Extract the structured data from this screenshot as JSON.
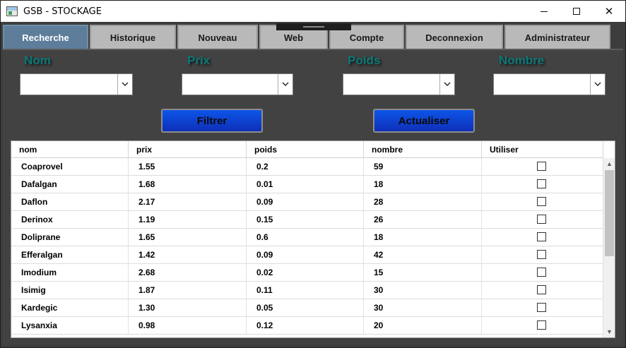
{
  "window": {
    "title": "GSB - STOCKAGE",
    "minimize_glyph": "",
    "close_glyph": "✕"
  },
  "tabs": [
    {
      "label": "Recherche",
      "active": true
    },
    {
      "label": "Historique",
      "active": false
    },
    {
      "label": "Nouveau",
      "active": false
    },
    {
      "label": "Web",
      "active": false
    },
    {
      "label": "Compte",
      "active": false
    },
    {
      "label": "Deconnexion",
      "active": false
    },
    {
      "label": "Administrateur",
      "active": false
    }
  ],
  "filters": {
    "nom_label": "Nom",
    "prix_label": "Prix",
    "poids_label": "Poids",
    "nombre_label": "Nombre",
    "nom_value": "",
    "prix_value": "",
    "poids_value": "",
    "nombre_value": ""
  },
  "buttons": {
    "filtrer": "Filtrer",
    "actualiser": "Actualiser"
  },
  "table": {
    "columns": [
      "nom",
      "prix",
      "poids",
      "nombre",
      "Utiliser"
    ],
    "rows": [
      {
        "nom": "Coaprovel",
        "prix": "1.55",
        "poids": "0.2",
        "nombre": "59",
        "utiliser": false
      },
      {
        "nom": "Dafalgan",
        "prix": "1.68",
        "poids": "0.01",
        "nombre": "18",
        "utiliser": false
      },
      {
        "nom": "Daflon",
        "prix": "2.17",
        "poids": "0.09",
        "nombre": "28",
        "utiliser": false
      },
      {
        "nom": "Derinox",
        "prix": "1.19",
        "poids": "0.15",
        "nombre": "26",
        "utiliser": false
      },
      {
        "nom": "Doliprane",
        "prix": "1.65",
        "poids": "0.6",
        "nombre": "18",
        "utiliser": false
      },
      {
        "nom": "Efferalgan",
        "prix": "1.42",
        "poids": "0.09",
        "nombre": "42",
        "utiliser": false
      },
      {
        "nom": "Imodium",
        "prix": "2.68",
        "poids": "0.02",
        "nombre": "15",
        "utiliser": false
      },
      {
        "nom": "Isimig",
        "prix": "1.87",
        "poids": "0.11",
        "nombre": "30",
        "utiliser": false
      },
      {
        "nom": "Kardegic",
        "prix": "1.30",
        "poids": "0.05",
        "nombre": "30",
        "utiliser": false
      },
      {
        "nom": "Lysanxia",
        "prix": "0.98",
        "poids": "0.12",
        "nombre": "20",
        "utiliser": false
      }
    ]
  },
  "colors": {
    "background": "#3d3d3d",
    "label_teal": "#0d7878",
    "button_blue": "#0d55e8",
    "tab_active": "#5d7d9a",
    "tab_inactive": "#b9b9b9"
  }
}
